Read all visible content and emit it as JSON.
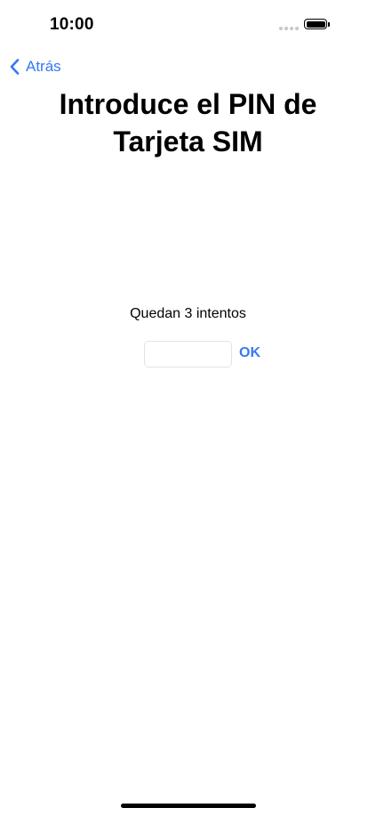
{
  "status_bar": {
    "time": "10:00",
    "icons": [
      "signal-dots-icon",
      "battery-icon"
    ]
  },
  "nav": {
    "back_label": "Atrás",
    "back_icon": "chevron-left-icon"
  },
  "page": {
    "title": "Introduce el PIN de Tarjeta SIM",
    "attempts_remaining": "Quedan 3 intentos",
    "pin_value": "",
    "pin_placeholder": "",
    "ok_label": "OK"
  },
  "colors": {
    "accent": "#3478f6",
    "text": "#000000",
    "background": "#ffffff"
  }
}
